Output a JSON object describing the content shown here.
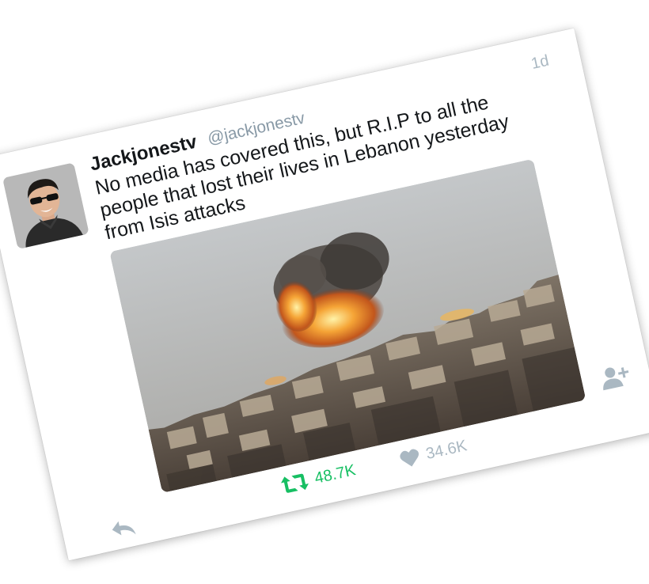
{
  "tweet": {
    "display_name": "Jackjonestv",
    "handle": "@jackjonestv",
    "timestamp": "1d",
    "text": "No media has covered this, but R.I.P to all the people that lost their lives in Lebanon yesterday from Isis attacks"
  },
  "actions": {
    "reply_icon": "reply-icon",
    "retweet_icon": "retweet-icon",
    "retweet_count": "48.7K",
    "like_icon": "heart-icon",
    "like_count": "34.6K",
    "follow_icon": "follow-icon"
  },
  "colors": {
    "retweet_active": "#17bf63",
    "muted": "#aab8c2",
    "text": "#14171a"
  }
}
